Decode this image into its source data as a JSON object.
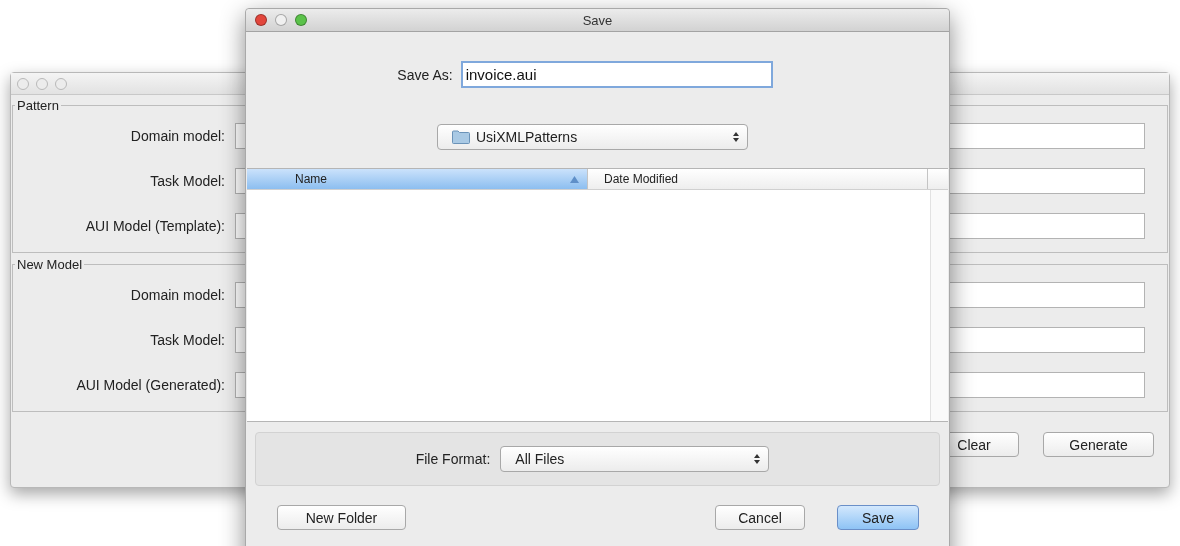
{
  "background_window": {
    "sections": [
      {
        "title": "Pattern",
        "fields": [
          {
            "label": "Domain model:"
          },
          {
            "label": "Task Model:"
          },
          {
            "label": "AUI Model (Template):"
          }
        ]
      },
      {
        "title": "New Model",
        "fields": [
          {
            "label": "Domain model:"
          },
          {
            "label": "Task Model:"
          },
          {
            "label": "AUI Model (Generated):"
          }
        ]
      }
    ],
    "buttons": [
      "Clear",
      "Generate"
    ]
  },
  "dialog": {
    "title": "Save",
    "save_as": {
      "label": "Save As:",
      "value": "invoice.aui"
    },
    "folder": "UsiXMLPatterns",
    "table": {
      "columns": [
        {
          "label": "Name",
          "selected": true
        },
        {
          "label": "Date Modified",
          "selected": false
        }
      ]
    },
    "file_format": {
      "label": "File Format:",
      "value": "All Files"
    },
    "buttons": [
      {
        "label": "New Folder",
        "default": false
      },
      {
        "label": "Cancel",
        "default": false
      },
      {
        "label": "Save",
        "default": true
      }
    ]
  }
}
